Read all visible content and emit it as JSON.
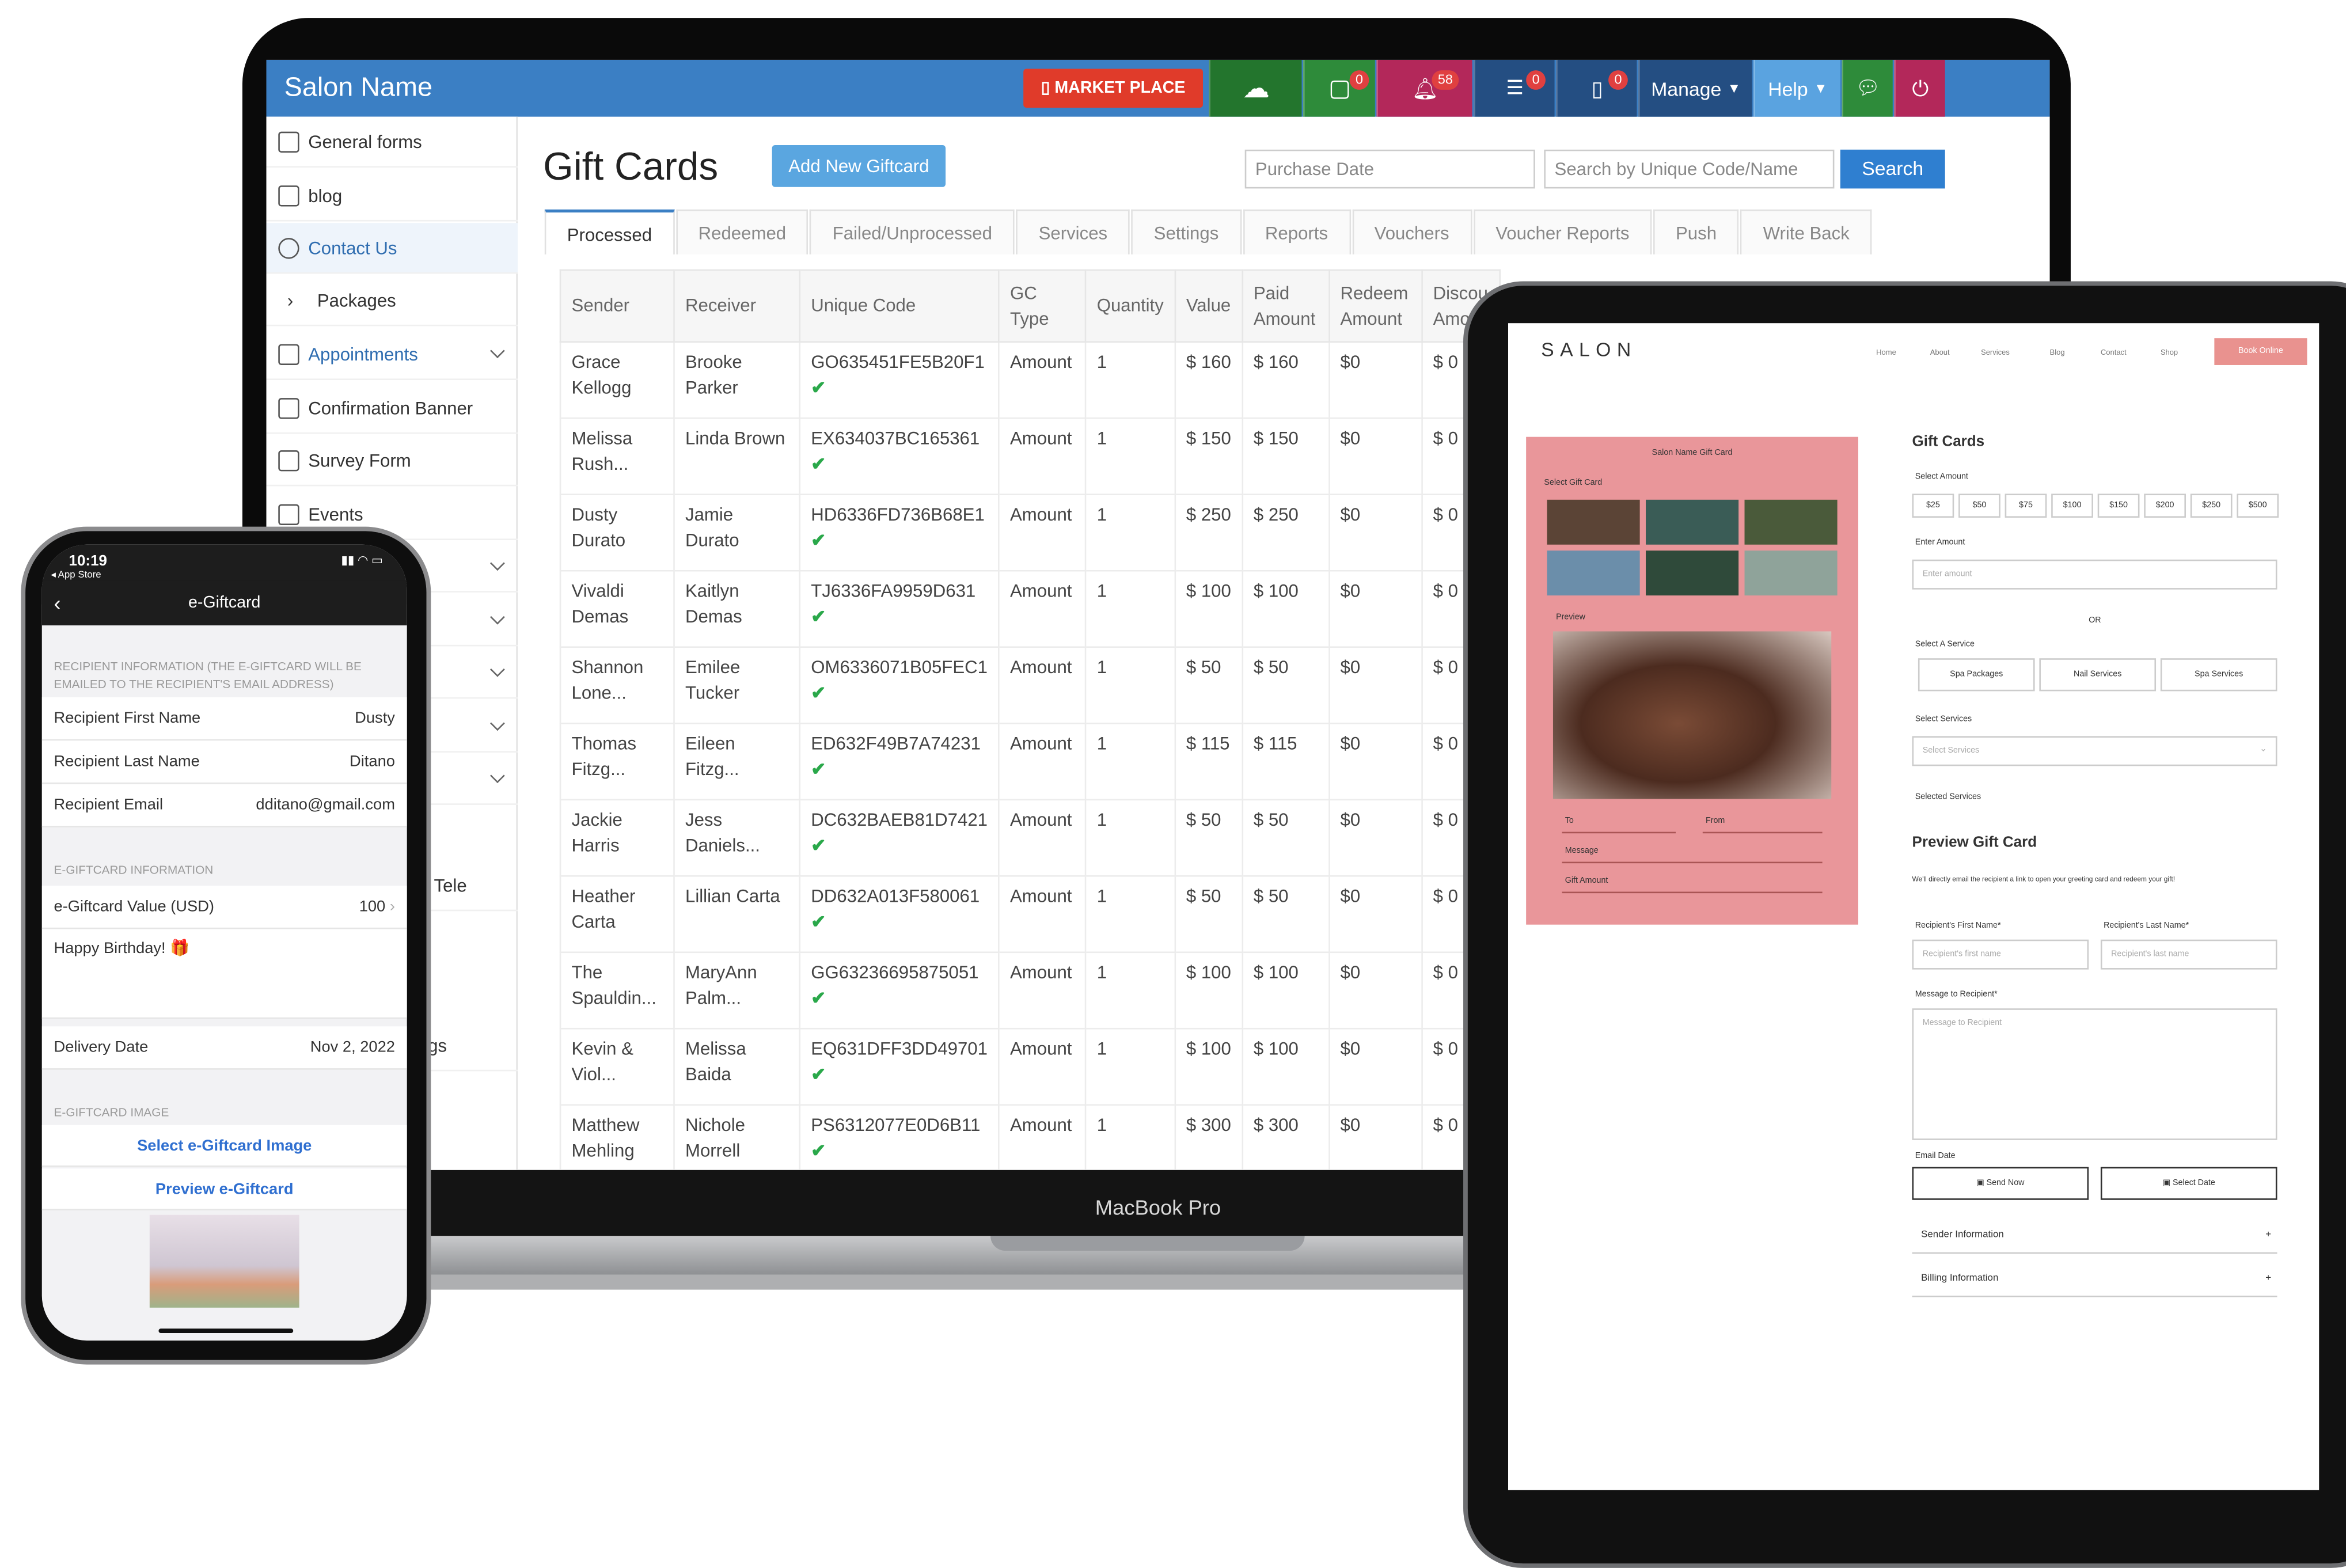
{
  "laptop": {
    "label": "MacBook Pro",
    "topbar": {
      "salon_name": "Salon Name",
      "marketplace": "MARKET PLACE",
      "cart_count": "0",
      "notif_count": "58",
      "msg_count": "0",
      "phone_count": "0",
      "manage": "Manage",
      "help": "Help"
    },
    "sidebar": {
      "items": [
        {
          "label": "General forms"
        },
        {
          "label": "blog"
        },
        {
          "label": "Contact Us"
        },
        {
          "label": "Packages"
        },
        {
          "label": "Appointments"
        },
        {
          "label": "Confirmation Banner"
        },
        {
          "label": "Survey Form"
        },
        {
          "label": "Events"
        }
      ],
      "partial_labels": [
        "Tele",
        "gs"
      ]
    },
    "page": {
      "title": "Gift Cards",
      "add_button": "Add New Giftcard",
      "date_placeholder": "Purchase Date",
      "search_placeholder": "Search by Unique Code/Name",
      "search_button": "Search"
    },
    "tabs": [
      "Processed",
      "Redeemed",
      "Failed/Unprocessed",
      "Services",
      "Settings",
      "Reports",
      "Vouchers",
      "Voucher Reports",
      "Push",
      "Write Back"
    ],
    "table": {
      "headers": [
        "Sender",
        "Receiver",
        "Unique Code",
        "GC Type",
        "Quantity",
        "Value",
        "Paid Amount",
        "Redeem Amount",
        "Discou Amo"
      ],
      "rows": [
        {
          "sender": "Grace Kellogg",
          "receiver": "Brooke Parker",
          "code": "GO635451FE5B20F1",
          "type": "Amount",
          "qty": "1",
          "value": "$ 160",
          "paid": "$ 160",
          "redeem": "$0",
          "disc": "$ 0"
        },
        {
          "sender": "Melissa Rush...",
          "receiver": "Linda Brown",
          "code": "EX634037BC165361",
          "type": "Amount",
          "qty": "1",
          "value": "$ 150",
          "paid": "$ 150",
          "redeem": "$0",
          "disc": "$ 0"
        },
        {
          "sender": "Dusty Durato",
          "receiver": "Jamie Durato",
          "code": "HD6336FD736B68E1",
          "type": "Amount",
          "qty": "1",
          "value": "$ 250",
          "paid": "$ 250",
          "redeem": "$0",
          "disc": "$ 0"
        },
        {
          "sender": "Vivaldi Demas",
          "receiver": "Kaitlyn Demas",
          "code": "TJ6336FA9959D631",
          "type": "Amount",
          "qty": "1",
          "value": "$ 100",
          "paid": "$ 100",
          "redeem": "$0",
          "disc": "$ 0"
        },
        {
          "sender": "Shannon Lone...",
          "receiver": "Emilee Tucker",
          "code": "OM6336071B05FEC1",
          "type": "Amount",
          "qty": "1",
          "value": "$ 50",
          "paid": "$ 50",
          "redeem": "$0",
          "disc": "$ 0"
        },
        {
          "sender": "Thomas Fitzg...",
          "receiver": "Eileen Fitzg...",
          "code": "ED632F49B7A74231",
          "type": "Amount",
          "qty": "1",
          "value": "$ 115",
          "paid": "$ 115",
          "redeem": "$0",
          "disc": "$ 0"
        },
        {
          "sender": "Jackie Harris",
          "receiver": "Jess Daniels...",
          "code": "DC632BAEB81D7421",
          "type": "Amount",
          "qty": "1",
          "value": "$ 50",
          "paid": "$ 50",
          "redeem": "$0",
          "disc": "$ 0"
        },
        {
          "sender": "Heather Carta",
          "receiver": "Lillian Carta",
          "code": "DD632A013F580061",
          "type": "Amount",
          "qty": "1",
          "value": "$ 50",
          "paid": "$ 50",
          "redeem": "$0",
          "disc": "$ 0"
        },
        {
          "sender": "The Spauldin...",
          "receiver": "MaryAnn Palm...",
          "code": "GG63236695875051",
          "type": "Amount",
          "qty": "1",
          "value": "$ 100",
          "paid": "$ 100",
          "redeem": "$0",
          "disc": "$ 0"
        },
        {
          "sender": "Kevin & Viol...",
          "receiver": "Melissa Baida",
          "code": "EQ631DFF3DD49701",
          "type": "Amount",
          "qty": "1",
          "value": "$ 100",
          "paid": "$ 100",
          "redeem": "$0",
          "disc": "$ 0"
        },
        {
          "sender": "Matthew Mehling",
          "receiver": "Nichole Morrell",
          "code": "PS6312077E0D6B11",
          "type": "Amount",
          "qty": "1",
          "value": "$ 300",
          "paid": "$ 300",
          "redeem": "$0",
          "disc": "$ 0"
        }
      ]
    }
  },
  "phone": {
    "time": "10:19",
    "carrier": "◂ App Store",
    "title": "e-Giftcard",
    "recipient_section": "RECIPIENT INFORMATION (THE E-GIFTCARD WILL BE EMAILED TO THE RECIPIENT'S EMAIL ADDRESS)",
    "fields": [
      {
        "label": "Recipient First Name",
        "value": "Dusty"
      },
      {
        "label": "Recipient Last Name",
        "value": "Ditano"
      },
      {
        "label": "Recipient Email",
        "value": "dditano@gmail.com"
      }
    ],
    "giftcard_section": "E-GIFTCARD INFORMATION",
    "value_label": "e-Giftcard Value (USD)",
    "value": "100",
    "message": "Happy Birthday! 🎁",
    "delivery_label": "Delivery Date",
    "delivery_value": "Nov 2, 2022",
    "image_section": "E-GIFTCARD IMAGE",
    "select_image": "Select e-Giftcard Image",
    "preview": "Preview e-Giftcard"
  },
  "tablet": {
    "logo": "SALON",
    "nav": [
      "Home",
      "About",
      "Services",
      "Blog",
      "Contact",
      "Shop"
    ],
    "book_button": "Book Online",
    "card_title": "Salon Name Gift Card",
    "select_card": "Select Gift Card",
    "preview_label": "Preview",
    "to_label": "To",
    "from_label": "From",
    "message_label": "Message",
    "amount_label": "Gift Amount",
    "gift_cards_heading": "Gift Cards",
    "select_amount": "Select Amount",
    "amounts": [
      "$25",
      "$50",
      "$75",
      "$100",
      "$150",
      "$200",
      "$250",
      "$500"
    ],
    "enter_amount": "Enter Amount",
    "enter_amount_placeholder": "Enter amount",
    "or": "OR",
    "select_service_label": "Select A Service",
    "service_buttons": [
      "Spa Packages",
      "Nail Services",
      "Spa Services"
    ],
    "select_services_label": "Select Services",
    "select_services_placeholder": "Select Services",
    "selected_services": "Selected Services",
    "preview_heading": "Preview Gift Card",
    "preview_text": "We'll directly email the recipient a link to open your greeting card and redeem your gift!",
    "first_name_label": "Recipient's First Name*",
    "first_name_placeholder": "Recipient's first name",
    "last_name_label": "Recipient's Last Name*",
    "last_name_placeholder": "Recipient's last name",
    "message_to_label": "Message to Recipient*",
    "message_placeholder": "Message to Recipient",
    "email_date_label": "Email Date",
    "send_now": "Send Now",
    "select_date": "Select Date",
    "sender_info": "Sender Information",
    "billing_info": "Billing Information",
    "plus": "+"
  },
  "colors": {
    "topbar": "#3b7fc4",
    "marketplace": "#e03b2a",
    "accent_blue": "#2f7fd0",
    "tick_green": "#2aa84a",
    "card_pink": "#e9969a"
  }
}
